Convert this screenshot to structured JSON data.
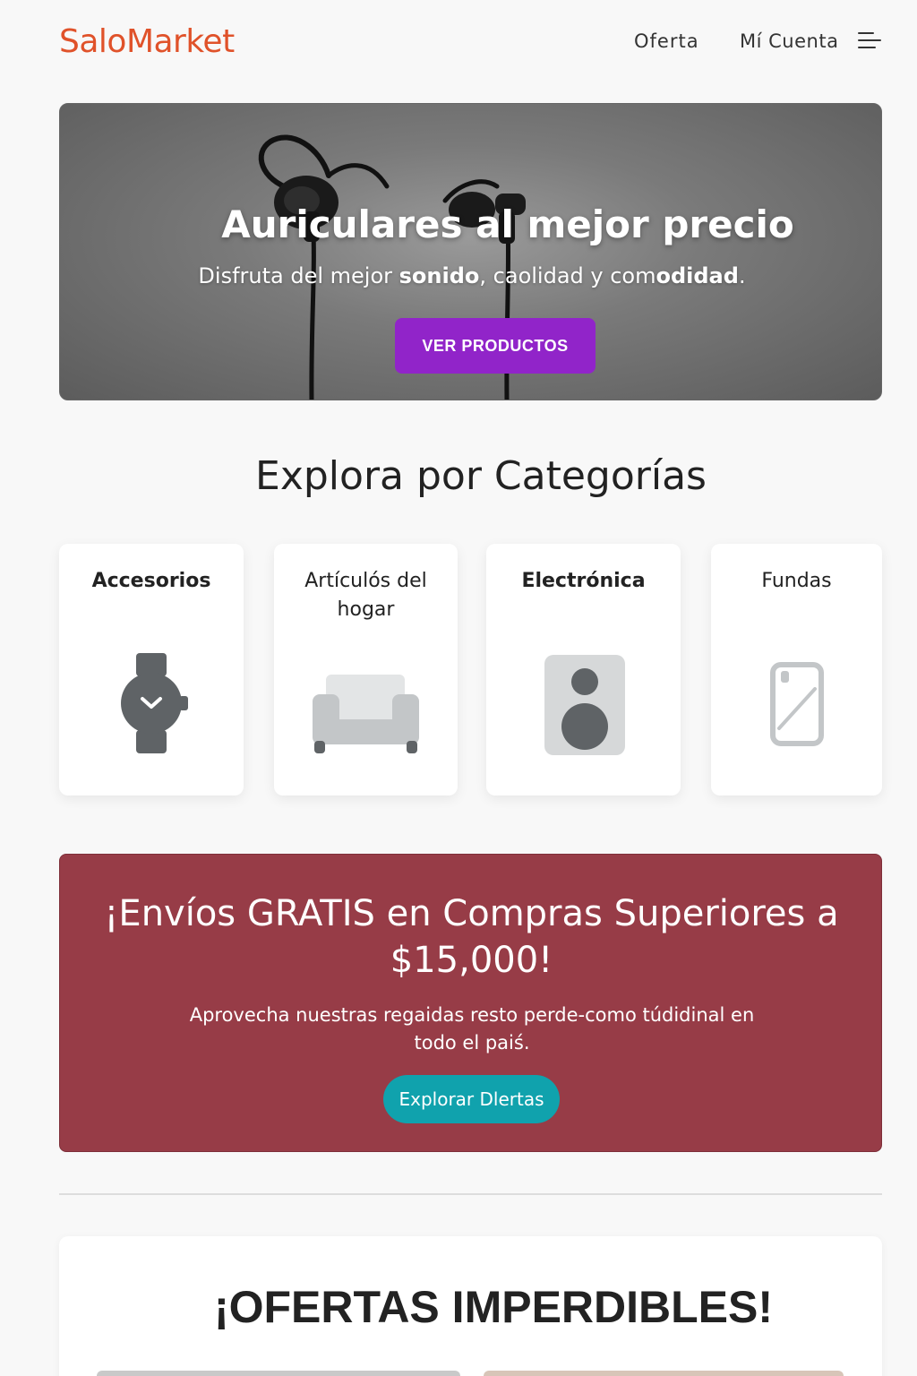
{
  "header": {
    "logo": "SaloMarket",
    "nav": [
      "Oferta",
      "Mí Cuenta"
    ]
  },
  "hero": {
    "title": "Auriculares al mejor precio",
    "subtitle_parts": [
      "Disfruta del mejor ",
      "sonido",
      ", caolidad y com",
      "odidad",
      "."
    ],
    "button_label": "VER PRODUCTOS"
  },
  "categories": {
    "title": "Explora por Categorías",
    "items": [
      {
        "label": "Accesorios",
        "icon": "watch-icon"
      },
      {
        "label": "Artículós del hogar",
        "icon": "sofa-icon"
      },
      {
        "label": "Electrónica",
        "icon": "speaker-icon"
      },
      {
        "label": "Fundas",
        "icon": "phone-case-icon"
      }
    ]
  },
  "shipping": {
    "title": "¡Envíos GRATIS en Compras Superiores a $15,000!",
    "subtitle": "Aprovecha nuestras regaidas resto perde-como túdidinal en todo el paiś.",
    "button_label": "Explorar Dlertas"
  },
  "offers": {
    "title": "¡OFERTAS IMPERDIBLES!"
  },
  "colors": {
    "brand": "#e0522a",
    "hero_button": "#9124c9",
    "banner": "#973c47",
    "banner_button": "#10a2ad"
  }
}
